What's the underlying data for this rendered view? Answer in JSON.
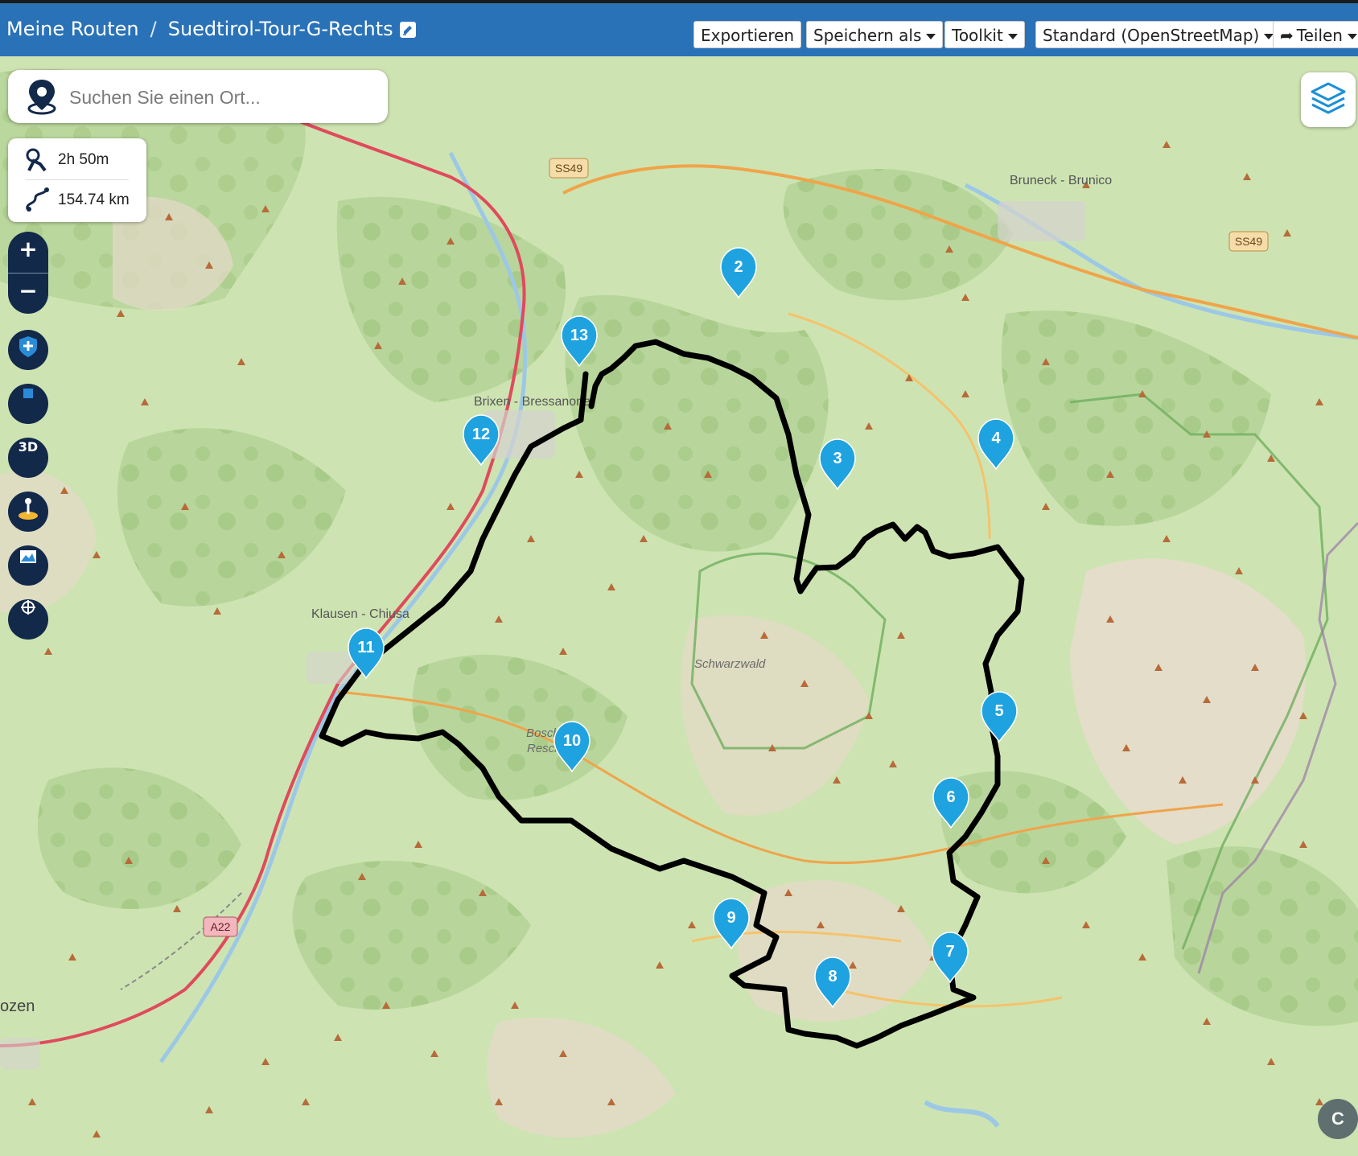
{
  "header": {
    "breadcrumb_root": "Meine Routen",
    "separator": "/",
    "route_title": "Suedtirol-Tour-G-Rechts",
    "buttons": {
      "export": "Exportieren",
      "save_as": "Speichern als",
      "toolkit": "Toolkit",
      "map_style": "Standard (OpenStreetMap)",
      "share": "Teilen"
    }
  },
  "search": {
    "placeholder": "Suchen Sie einen Ort..."
  },
  "stats": {
    "duration": "2h 50m",
    "distance": "154.74 km"
  },
  "controls": {
    "zoom_in": "+",
    "zoom_out": "−",
    "three_d": "3D"
  },
  "map_labels": {
    "brixen": "Brixen - Bressanone",
    "klausen": "Klausen - Chiusa",
    "bruneck": "Bruneck - Brunico",
    "schwarzwald": "Schwarzwald",
    "bosch_line1": "Bosch de",
    "bosch_line2": "Resciesa",
    "bozen": "ozen",
    "road_ss49_a": "SS49",
    "road_ss49_b": "SS49",
    "road_a22": "A22"
  },
  "waypoints": [
    "2",
    "3",
    "4",
    "5",
    "6",
    "7",
    "8",
    "9",
    "10",
    "11",
    "12",
    "13"
  ],
  "colors": {
    "header": "#2a72b8",
    "marker": "#1fa3e0",
    "route": "#000000",
    "map_base": "#cfe3b4"
  },
  "attribution_icon": "C"
}
